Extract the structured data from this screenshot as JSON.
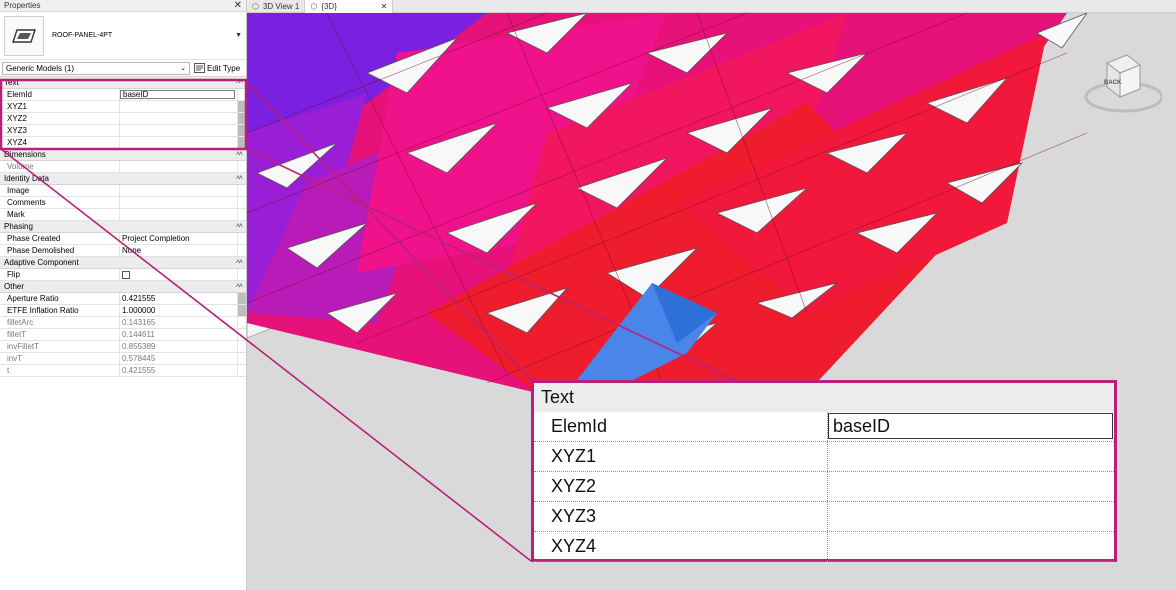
{
  "properties_panel": {
    "title": "Properties",
    "close_glyph": "✕",
    "type_name": "ROOF-PANEL-4PT",
    "type_icon": "roof-panel-type-icon",
    "filter": "Generic Models (1)",
    "edit_type": "Edit Type",
    "sections": {
      "text": {
        "label": "Text",
        "rows": [
          {
            "name": "ElemId",
            "value": "baseID"
          },
          {
            "name": "XYZ1",
            "value": ""
          },
          {
            "name": "XYZ2",
            "value": ""
          },
          {
            "name": "XYZ3",
            "value": ""
          },
          {
            "name": "XYZ4",
            "value": ""
          }
        ]
      },
      "dimensions": {
        "label": "Dimensions",
        "rows": [
          {
            "name": "Volume",
            "value": ""
          }
        ]
      },
      "identity": {
        "label": "Identity Data",
        "rows": [
          {
            "name": "Image",
            "value": ""
          },
          {
            "name": "Comments",
            "value": ""
          },
          {
            "name": "Mark",
            "value": ""
          }
        ]
      },
      "phasing": {
        "label": "Phasing",
        "rows": [
          {
            "name": "Phase Created",
            "value": "Project Completion"
          },
          {
            "name": "Phase Demolished",
            "value": "None"
          }
        ]
      },
      "adaptive": {
        "label": "Adaptive Component",
        "rows": [
          {
            "name": "Flip",
            "value": ""
          }
        ]
      },
      "other": {
        "label": "Other",
        "rows": [
          {
            "name": "Aperture Ratio",
            "value": "0.421555"
          },
          {
            "name": "ETFE Inflation Ratio",
            "value": "1.000000"
          },
          {
            "name": "filletArc",
            "value": "0.143165"
          },
          {
            "name": "filletT",
            "value": "0.144611"
          },
          {
            "name": "invFilletT",
            "value": "0.855389"
          },
          {
            "name": "invT",
            "value": "0.578445"
          },
          {
            "name": "t",
            "value": "0.421555"
          }
        ]
      }
    }
  },
  "tabs": [
    {
      "label": "3D View 1",
      "active": false
    },
    {
      "label": "{3D}",
      "active": true,
      "close": "✕"
    }
  ],
  "viewcube": {
    "face_label": "BACK"
  },
  "callout": {
    "header": "Text",
    "rows": [
      {
        "name": "ElemId",
        "value": "baseID"
      },
      {
        "name": "XYZ1",
        "value": ""
      },
      {
        "name": "XYZ2",
        "value": ""
      },
      {
        "name": "XYZ3",
        "value": ""
      },
      {
        "name": "XYZ4",
        "value": ""
      }
    ]
  },
  "colors": {
    "highlight": "#b8207a",
    "panel_red": "#ee1c2d",
    "panel_blue": "#4a86ea",
    "panel_violet": "#7a20e0"
  }
}
